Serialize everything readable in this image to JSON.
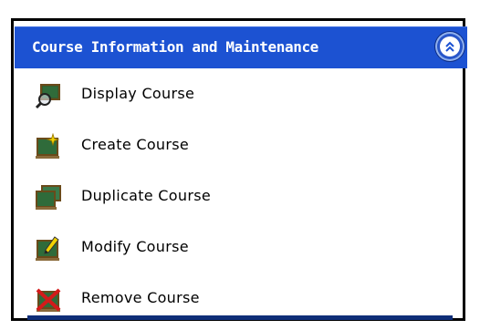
{
  "panel": {
    "title": "Course Information and Maintenance",
    "collapse_icon": "double-chevron-up-icon",
    "header_color": "#1c52d2"
  },
  "menu": {
    "items": [
      {
        "label": "Display Course",
        "icon": "magnifier-board-icon"
      },
      {
        "label": "Create Course",
        "icon": "sparkle-board-icon"
      },
      {
        "label": "Duplicate Course",
        "icon": "stacked-boards-icon"
      },
      {
        "label": "Modify Course",
        "icon": "pencil-board-icon"
      },
      {
        "label": "Remove Course",
        "icon": "red-x-board-icon"
      }
    ]
  }
}
